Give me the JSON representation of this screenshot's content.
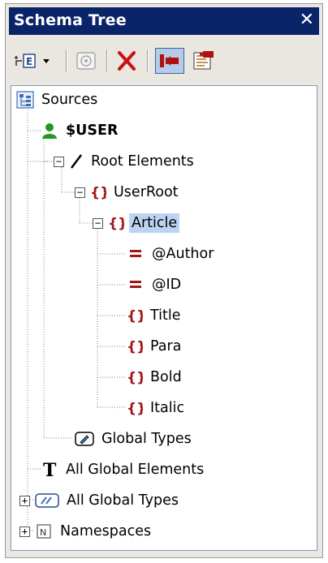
{
  "window": {
    "title": "Schema Tree",
    "close_glyph": "✕"
  },
  "toolbar": {
    "buttons": [
      {
        "name": "add-element-icon",
        "dropdown": true
      },
      {
        "name": "disabled-icon"
      },
      {
        "name": "delete-icon"
      },
      {
        "name": "map-icon",
        "active": true
      },
      {
        "name": "schema-icon"
      }
    ]
  },
  "tree": {
    "sources": "Sources",
    "user": "$USER",
    "root_elements": "Root Elements",
    "userroot": "UserRoot",
    "article": "Article",
    "author": "@Author",
    "id": "@ID",
    "title": "Title",
    "para": "Para",
    "bold": "Bold",
    "italic": "Italic",
    "global_types": "Global Types",
    "all_global_elements": "All Global Elements",
    "all_global_types": "All Global Types",
    "namespaces": "Namespaces",
    "expander_minus": "−",
    "expander_plus": "+"
  },
  "colors": {
    "title_bar": "#0a246a",
    "element_icon": "#a01818",
    "user_icon": "#1e9a1e",
    "delete_icon": "#cc1111",
    "selection": "#bcd3f2"
  }
}
